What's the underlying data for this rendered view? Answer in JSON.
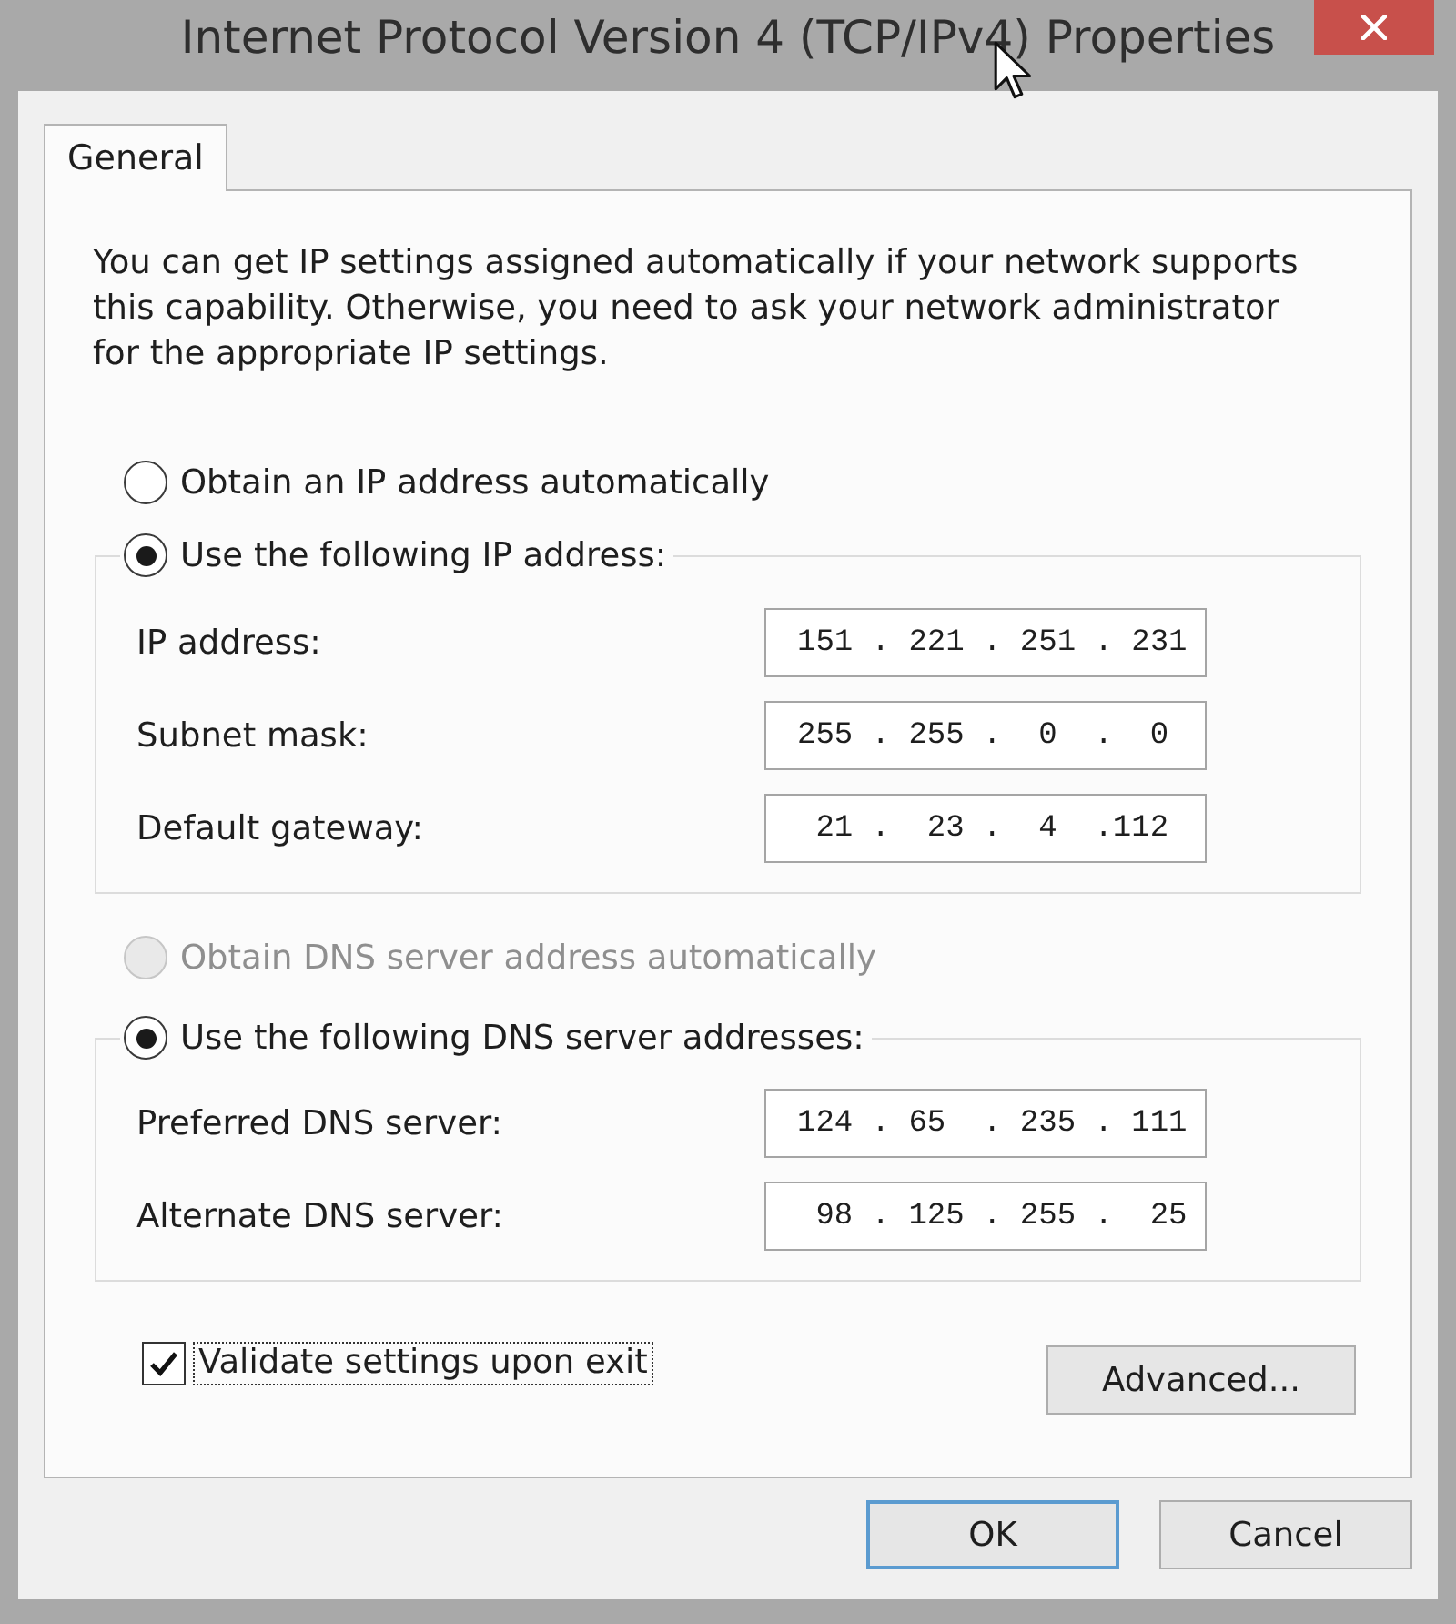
{
  "window": {
    "title": "Internet Protocol Version 4 (TCP/IPv4) Properties"
  },
  "tabs": [
    {
      "label": "General",
      "selected": true
    }
  ],
  "description": "You can get IP settings assigned automatically if your network supports this capability. Otherwise, you need to ask your network administrator for the appropriate IP settings.",
  "ip_settings": {
    "automatic": {
      "label": "Obtain an IP address automatically",
      "selected": false,
      "disabled": false
    },
    "manual": {
      "label": "Use the following IP address:",
      "selected": true,
      "disabled": false
    },
    "fields": [
      {
        "label": "IP address:",
        "value": "151 . 221 . 251 . 231"
      },
      {
        "label": "Subnet mask:",
        "value": "255 . 255 .  0  .  0"
      },
      {
        "label": "Default gateway:",
        "value": " 21 .  23 .  4  .112"
      }
    ]
  },
  "dns_settings": {
    "automatic": {
      "label": "Obtain DNS server address automatically",
      "selected": false,
      "disabled": true
    },
    "manual": {
      "label": "Use the following DNS server addresses:",
      "selected": true,
      "disabled": false
    },
    "fields": [
      {
        "label": "Preferred DNS server:",
        "value": "124 . 65  . 235 . 111"
      },
      {
        "label": "Alternate DNS server:",
        "value": " 98 . 125 . 255 .  25"
      }
    ]
  },
  "validate_checkbox": {
    "label": "Validate settings upon exit",
    "checked": true,
    "focused": true
  },
  "advanced_button": {
    "label": "Advanced..."
  },
  "buttons": [
    {
      "label": "OK",
      "default": true
    },
    {
      "label": "Cancel",
      "default": false
    }
  ]
}
